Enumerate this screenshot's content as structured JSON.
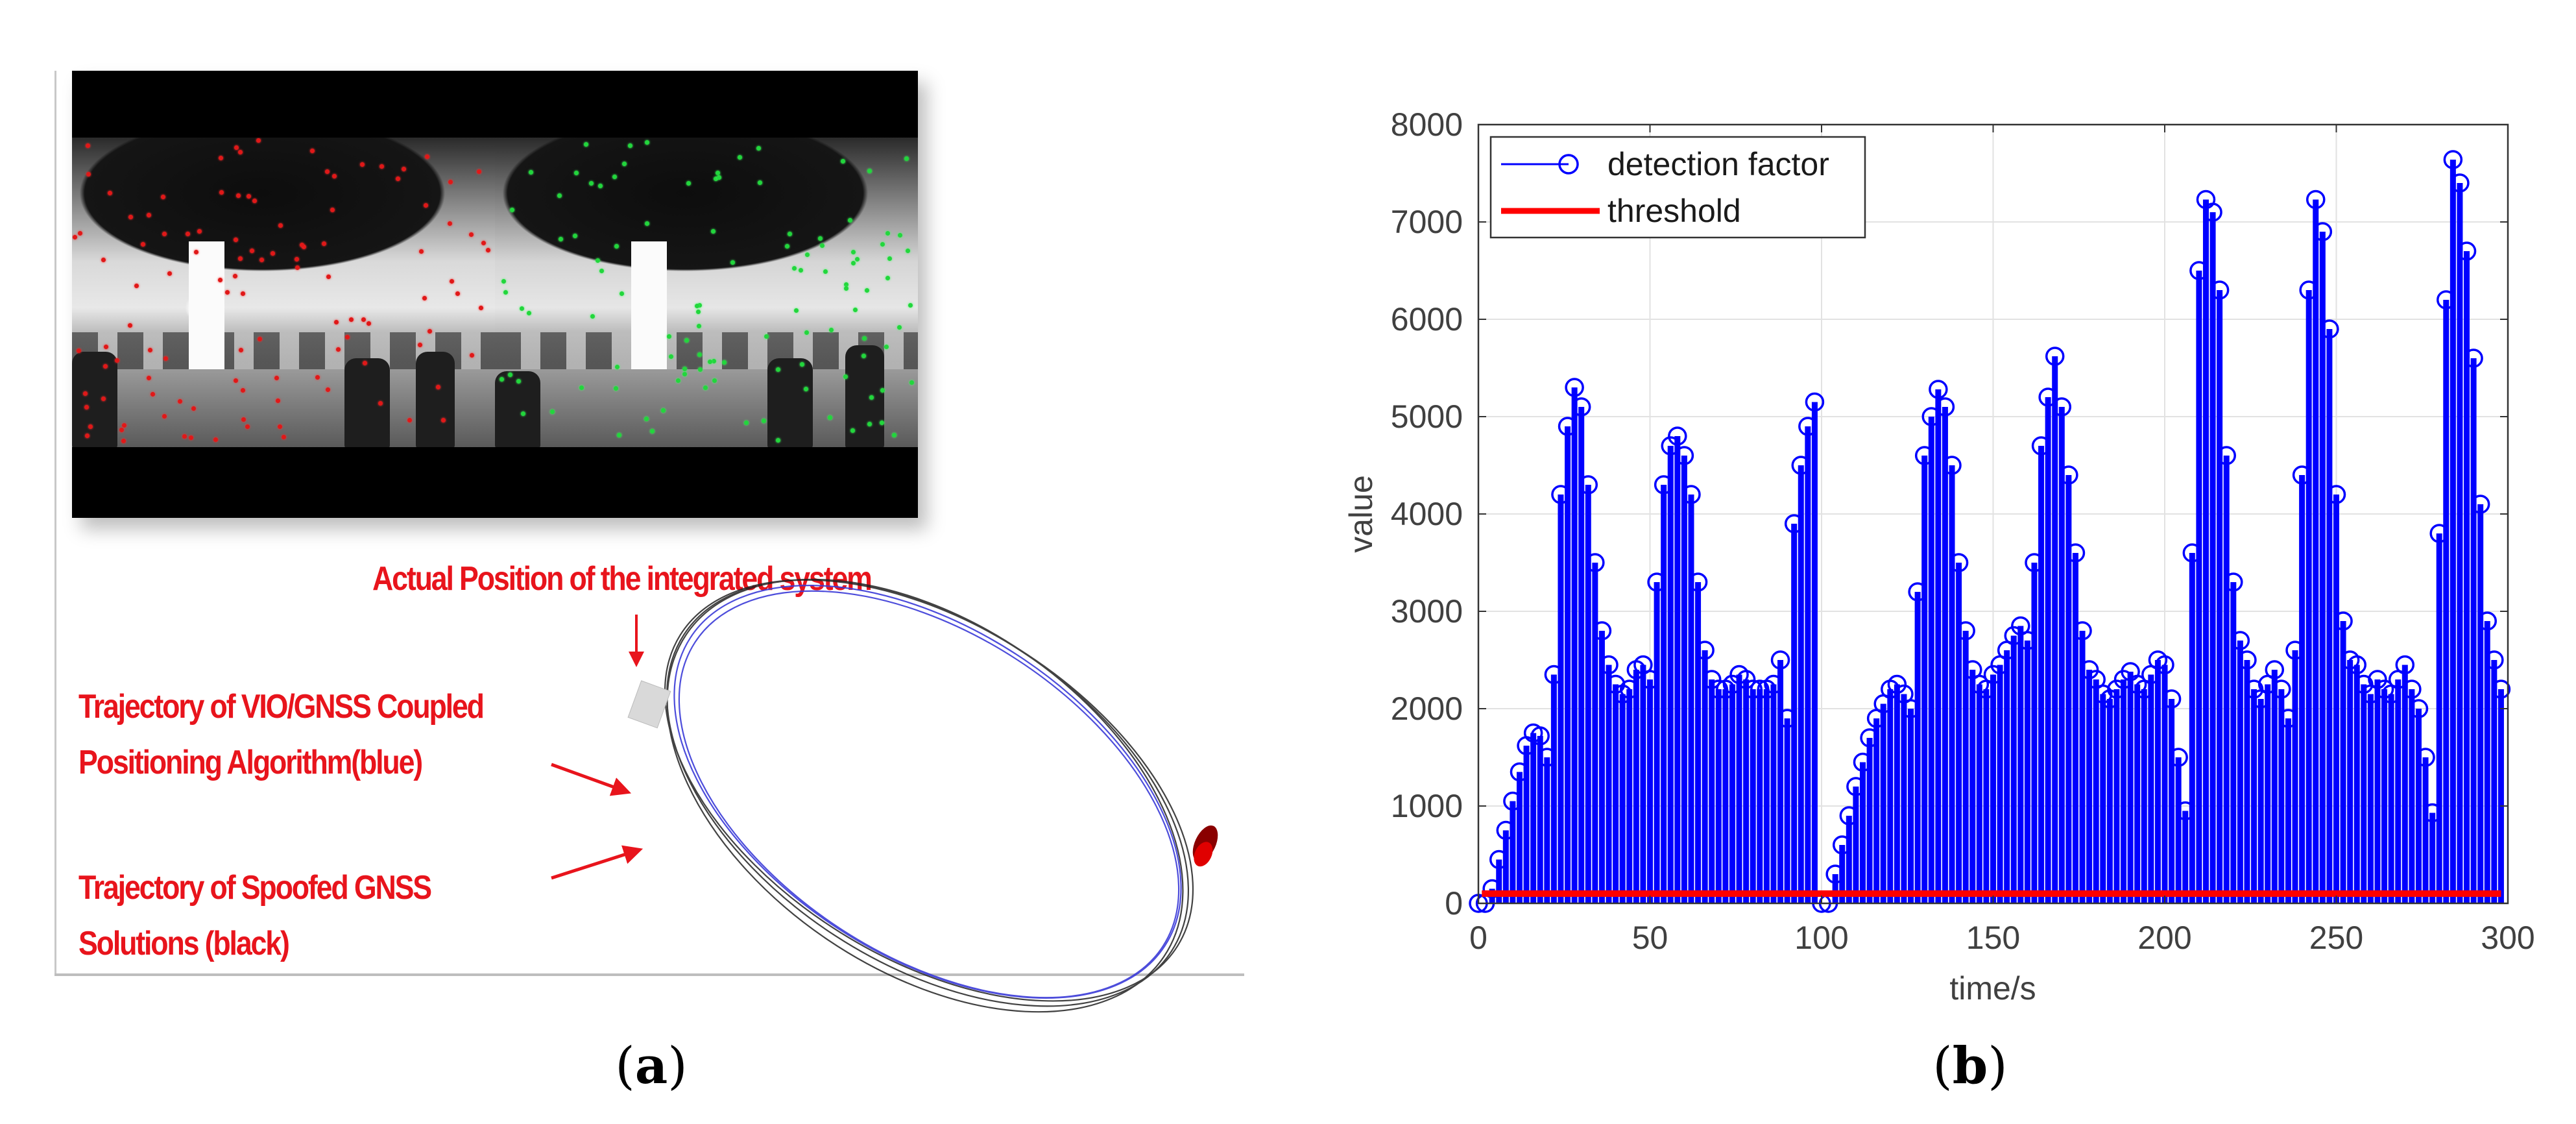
{
  "figure": {
    "panels": [
      {
        "id": "a",
        "caption_letter": "a",
        "camera_views": {
          "left_feature_color": "#e01818",
          "right_feature_color": "#22d63c"
        },
        "annotations": {
          "actual_position": "Actual  Position of the integrated system",
          "vio_gnss_line1": "Trajectory of VIO/GNSS Coupled",
          "vio_gnss_line2": "Positioning Algorithm(blue)",
          "spoofed_line1": "Trajectory of Spoofed GNSS",
          "spoofed_line2": "Solutions (black)"
        },
        "trajectory_colors": {
          "vio_gnss": "#3a3ad8",
          "spoofed_gnss": "#222222",
          "annotation": "#e8141c"
        }
      },
      {
        "id": "b",
        "caption_letter": "b"
      }
    ]
  },
  "chart_data": {
    "type": "stem",
    "title": "",
    "xlabel": "time/s",
    "ylabel": "value",
    "xlim": [
      0,
      300
    ],
    "ylim": [
      0,
      8000
    ],
    "xticks": [
      0,
      50,
      100,
      150,
      200,
      250,
      300
    ],
    "yticks": [
      0,
      1000,
      2000,
      3000,
      4000,
      5000,
      6000,
      7000,
      8000
    ],
    "xtick_labels": [
      "0",
      "50",
      "100",
      "150",
      "200",
      "250",
      "300"
    ],
    "ytick_labels": [
      "0",
      "1000",
      "2000",
      "3000",
      "4000",
      "5000",
      "6000",
      "7000",
      "8000"
    ],
    "grid": true,
    "legend_position": "top-left",
    "series": [
      {
        "name": "detection factor",
        "style": "stem with circle markers",
        "color": "#0000ff",
        "x_start": 0,
        "x_step": 2,
        "values": [
          0,
          0,
          150,
          450,
          750,
          1050,
          1350,
          1620,
          1750,
          1720,
          1500,
          2350,
          4200,
          4900,
          5300,
          5100,
          4300,
          3500,
          2800,
          2450,
          2250,
          2150,
          2200,
          2400,
          2450,
          2300,
          3300,
          4300,
          4700,
          4800,
          4600,
          4200,
          3300,
          2600,
          2300,
          2200,
          2200,
          2250,
          2350,
          2300,
          2200,
          2200,
          2200,
          2250,
          2500,
          1900,
          3900,
          4500,
          4900,
          5150,
          0,
          0,
          300,
          600,
          900,
          1200,
          1450,
          1700,
          1900,
          2050,
          2200,
          2250,
          2150,
          2000,
          3200,
          4600,
          5000,
          5280,
          5100,
          4500,
          3500,
          2800,
          2400,
          2250,
          2200,
          2350,
          2450,
          2600,
          2750,
          2850,
          2700,
          3500,
          4700,
          5200,
          5620,
          5100,
          4400,
          3600,
          2800,
          2400,
          2300,
          2150,
          2100,
          2200,
          2300,
          2380,
          2250,
          2200,
          2350,
          2500,
          2450,
          2100,
          1500,
          950,
          3600,
          6500,
          7230,
          7100,
          6300,
          4600,
          3300,
          2700,
          2500,
          2200,
          2100,
          2250,
          2400,
          2200,
          1900,
          2600,
          4400,
          6300,
          7230,
          6900,
          5900,
          4200,
          2900,
          2500,
          2450,
          2250,
          2150,
          2300,
          2200,
          2150,
          2300,
          2450,
          2200,
          2000,
          1500,
          930,
          3800,
          6200,
          7640,
          7400,
          6700,
          5600,
          4100,
          2900,
          2500,
          2200
        ]
      },
      {
        "name": "threshold",
        "style": "line",
        "color": "#ff0000",
        "x": [
          1,
          298
        ],
        "values": [
          100,
          100
        ]
      }
    ]
  }
}
